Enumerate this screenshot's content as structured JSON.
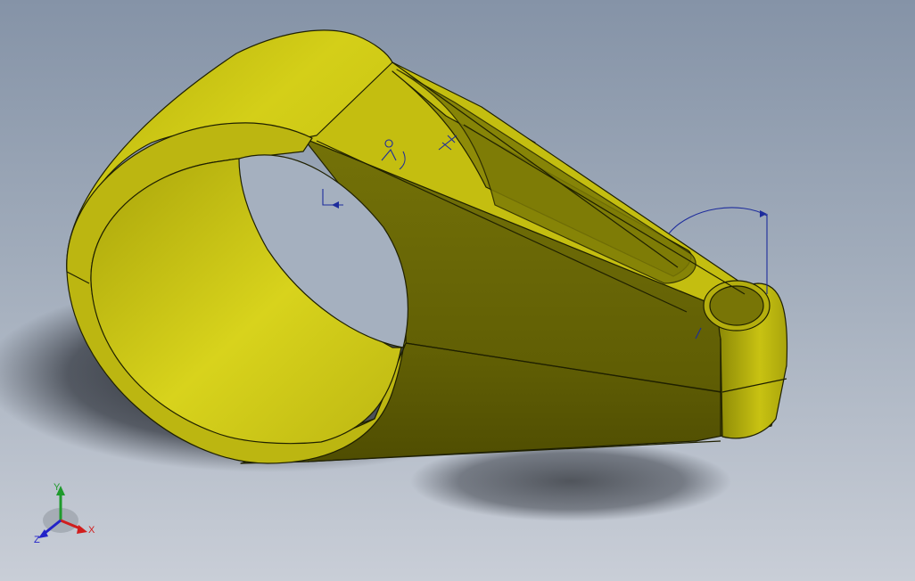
{
  "viewport": {
    "background_top": "#8593a7",
    "background_bottom": "#c9ced7"
  },
  "model": {
    "face_color": "#c9c416",
    "shade_color": "#6b6a05",
    "edge_color": "#1f2000",
    "annotation_color": "#1d2c9c"
  },
  "triad": {
    "x_label": "X",
    "y_label": "Y",
    "z_label": "Z",
    "x_color": "#d11d1d",
    "y_color": "#1f9a2c",
    "z_color": "#2222c8"
  }
}
